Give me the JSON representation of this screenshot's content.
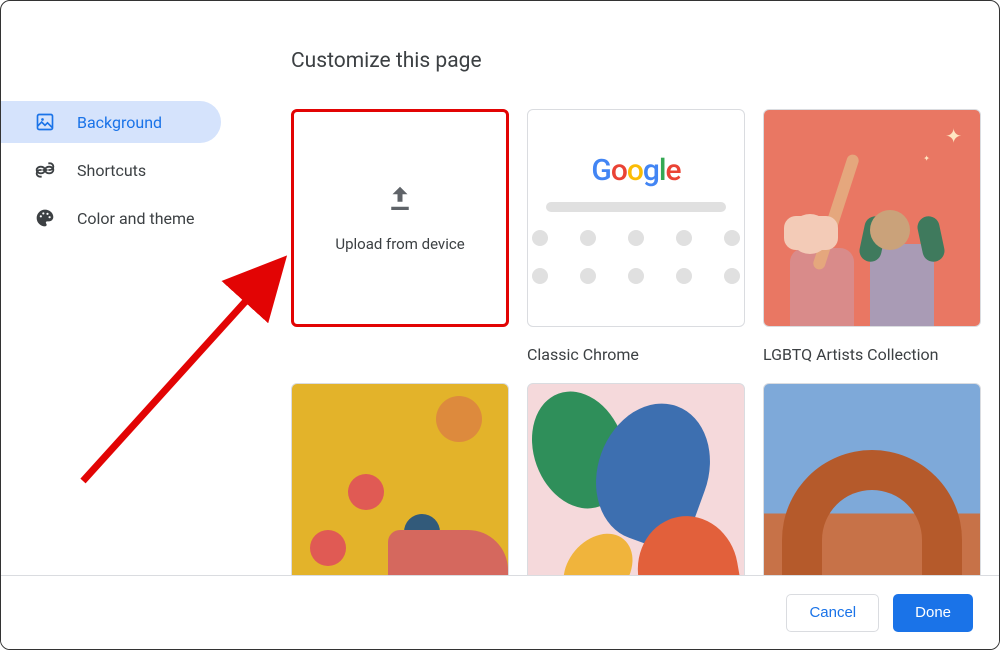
{
  "title": "Customize this page",
  "sidebar": {
    "items": [
      {
        "id": "background",
        "label": "Background",
        "active": true,
        "icon": "image-icon"
      },
      {
        "id": "shortcuts",
        "label": "Shortcuts",
        "active": false,
        "icon": "link-icon"
      },
      {
        "id": "color",
        "label": "Color and theme",
        "active": false,
        "icon": "palette-icon"
      }
    ]
  },
  "backgrounds": {
    "upload": {
      "label": "Upload from device",
      "highlighted": true
    },
    "tiles": [
      {
        "id": "classic",
        "label": "Classic Chrome",
        "type": "classic"
      },
      {
        "id": "lgbtq",
        "label": "LGBTQ Artists Collection",
        "type": "lgbtq"
      },
      {
        "id": "latino",
        "label": "",
        "type": "latino"
      },
      {
        "id": "native",
        "label": "",
        "type": "native"
      },
      {
        "id": "earth",
        "label": "",
        "type": "earth"
      }
    ]
  },
  "footer": {
    "cancel": "Cancel",
    "done": "Done"
  },
  "annotation": {
    "type": "arrow",
    "color": "#e20404",
    "points_to": "upload-tile"
  }
}
